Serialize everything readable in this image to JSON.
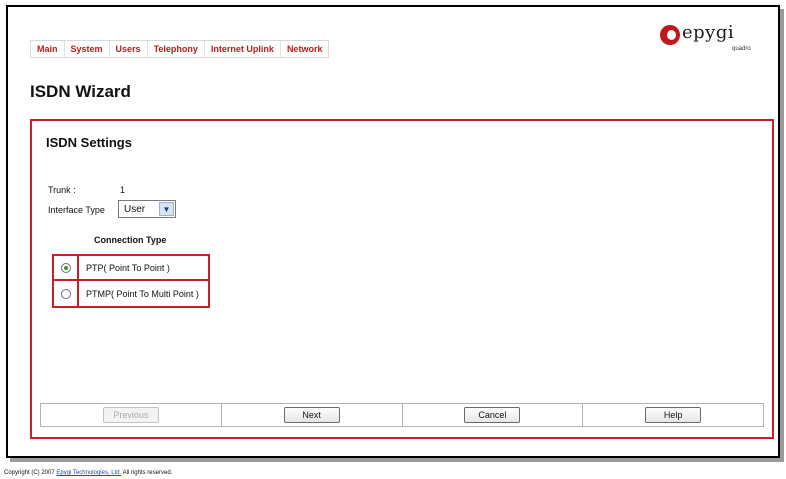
{
  "nav": {
    "items": [
      {
        "label": "Main"
      },
      {
        "label": "System"
      },
      {
        "label": "Users"
      },
      {
        "label": "Telephony"
      },
      {
        "label": "Internet Uplink"
      },
      {
        "label": "Network"
      }
    ]
  },
  "logo": {
    "text": "epygi",
    "sub": "quadro",
    "icon": "epygi-logo-icon"
  },
  "page": {
    "title": "ISDN Wizard"
  },
  "panel": {
    "title": "ISDN Settings",
    "trunk_label": "Trunk :",
    "trunk_value": "1",
    "interface_label": "Interface Type",
    "interface_value": "User",
    "connection_title": "Connection Type",
    "options": [
      {
        "label": "PTP( Point To Point )",
        "checked": true
      },
      {
        "label": "PTMP( Point To Multi Point )",
        "checked": false
      }
    ]
  },
  "buttons": {
    "previous": "Previous",
    "next": "Next",
    "cancel": "Cancel",
    "help": "Help"
  },
  "footer": {
    "prefix": "Copyright (C) 2007 ",
    "link": "Epygi Technologies, Ltd.",
    "suffix": " All rights reserved."
  },
  "colors": {
    "accent": "#c8202a",
    "nav_text": "#c01a1a",
    "link": "#1a4fa8"
  }
}
